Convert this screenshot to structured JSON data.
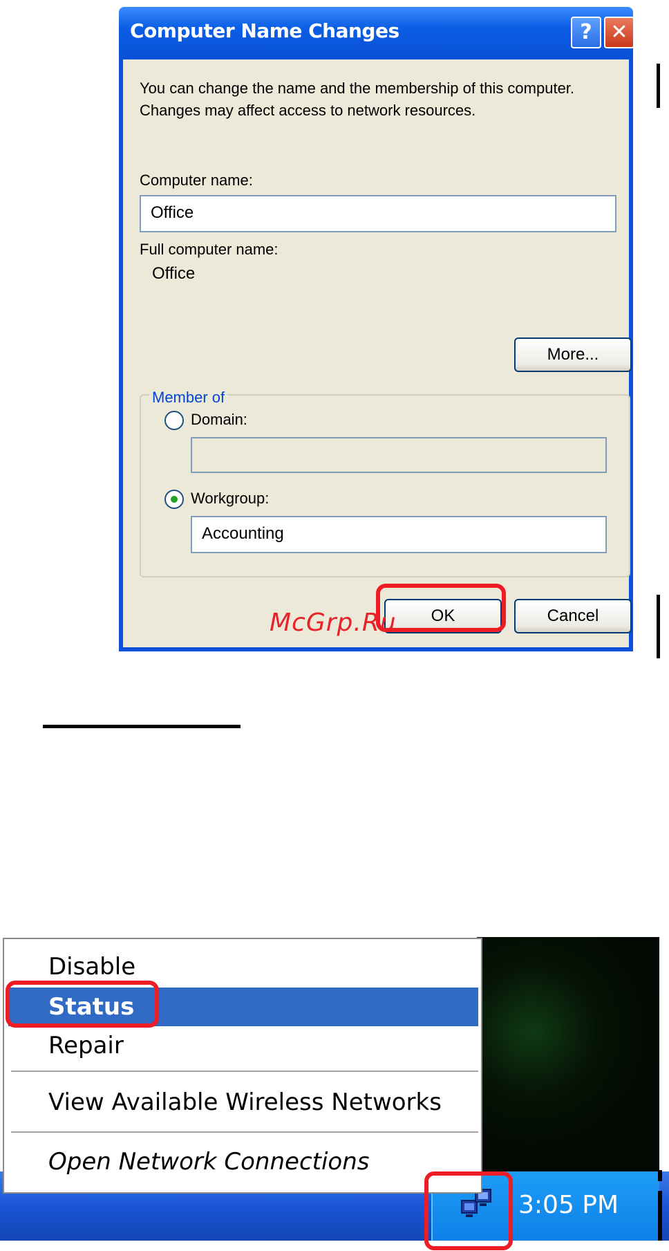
{
  "dialog": {
    "title": "Computer Name Changes",
    "help_glyph": "?",
    "close_glyph": "✕",
    "description": "You can change the name and the membership of this computer. Changes may affect access to network resources.",
    "computer_name_label": "Computer name:",
    "computer_name_value": "Office",
    "full_name_label": "Full computer name:",
    "full_name_value": "Office",
    "more_button": "More...",
    "member_of": {
      "title": "Member of",
      "domain_label": "Domain:",
      "domain_value": "",
      "domain_selected": false,
      "workgroup_label": "Workgroup:",
      "workgroup_value": "Accounting",
      "workgroup_selected": true
    },
    "ok_button": "OK",
    "cancel_button": "Cancel"
  },
  "watermark": "McGrp.Ru",
  "context_menu": {
    "items": [
      {
        "label": "Disable",
        "selected": false
      },
      {
        "label": "Status",
        "selected": true
      },
      {
        "label": "Repair",
        "selected": false
      },
      {
        "label": "View Available Wireless Networks",
        "selected": false
      },
      {
        "label": "Open Network Connections",
        "selected": false
      }
    ]
  },
  "taskbar": {
    "clock": "3:05 PM",
    "tray_icon": "network-connection-icon"
  },
  "colors": {
    "highlight": "#ee1c25",
    "menu_selection": "#316ac5",
    "title_bar": "#0a53d8",
    "dialog_face": "#ece9d8"
  }
}
